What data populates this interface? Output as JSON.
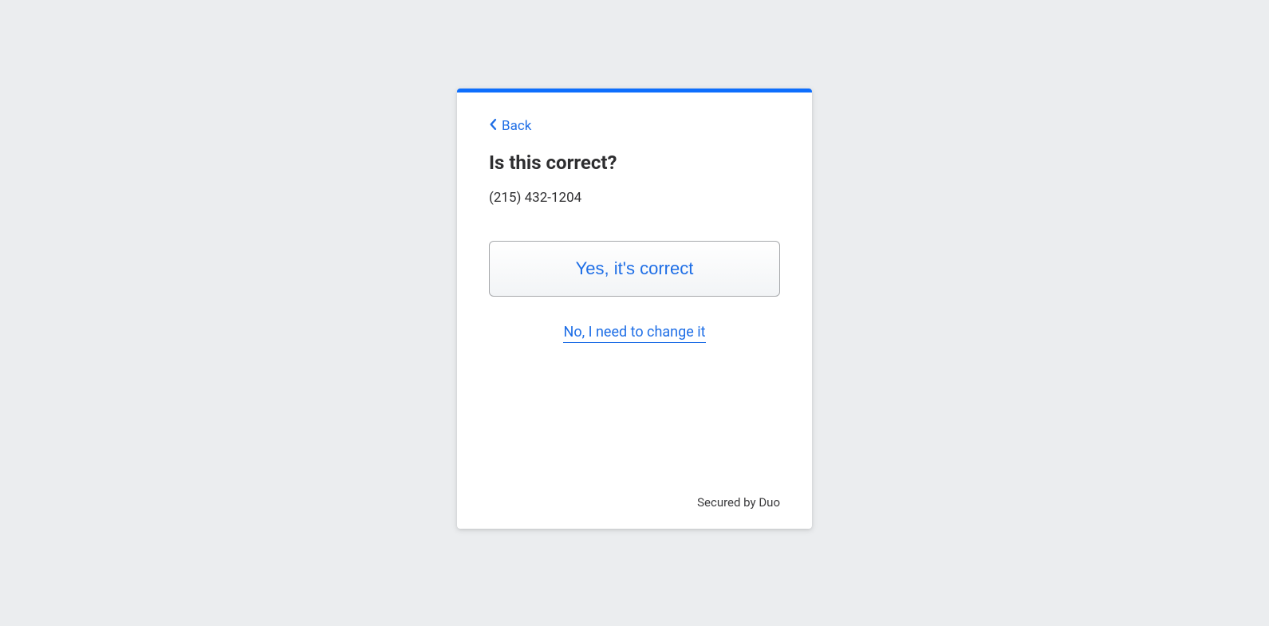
{
  "back": {
    "label": "Back"
  },
  "heading": "Is this correct?",
  "phone": "(215) 432-1204",
  "actions": {
    "confirm_label": "Yes, it's correct",
    "change_label": "No, I need to change it"
  },
  "footer": {
    "secured_label": "Secured by Duo"
  },
  "colors": {
    "accent": "#0d6efd",
    "link": "#1e6ee6",
    "background": "#ebedef"
  }
}
